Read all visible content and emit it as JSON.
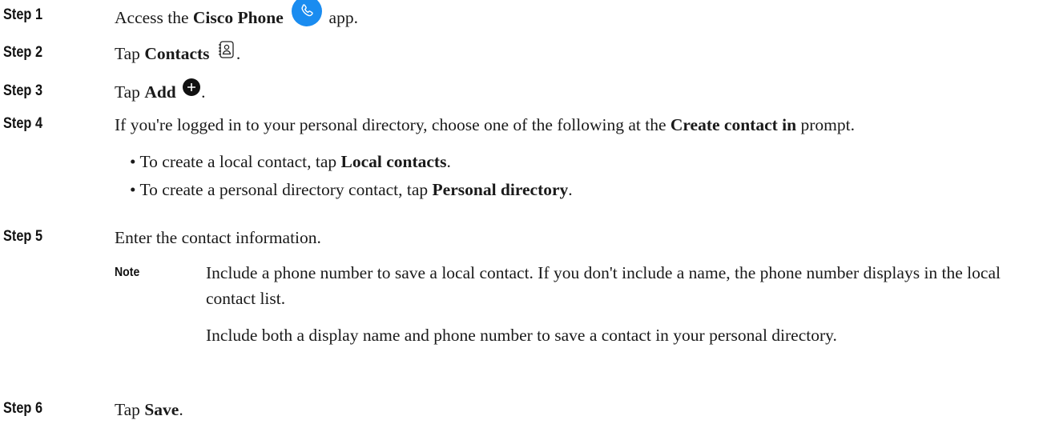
{
  "steps": [
    {
      "label": "Step 1",
      "before": "Access the ",
      "bold": "Cisco Phone",
      "icon": "phone-app-icon",
      "after": " app."
    },
    {
      "label": "Step 2",
      "before": "Tap ",
      "bold": "Contacts",
      "icon": "contacts-icon",
      "after": "."
    },
    {
      "label": "Step 3",
      "before": "Tap ",
      "bold": "Add",
      "icon": "add-icon",
      "after": "."
    },
    {
      "label": "Step 4",
      "before": "If you're logged in to your personal directory, choose one of the following at the ",
      "bold": "Create contact in",
      "after": " prompt.",
      "bullets": [
        {
          "before": "• To create a local contact, tap ",
          "bold": "Local contacts",
          "after": "."
        },
        {
          "before": "• To create a personal directory contact, tap ",
          "bold": "Personal directory",
          "after": "."
        }
      ]
    },
    {
      "label": "Step 5",
      "text": "Enter the contact information.",
      "note": {
        "label": "Note",
        "para1": "Include a phone number to save a local contact. If you don't include a name, the phone number displays in the local contact list.",
        "para2": "Include both a display name and phone number to save a contact in your personal directory."
      }
    },
    {
      "label": "Step 6",
      "before": "Tap ",
      "bold": "Save",
      "after": "."
    }
  ],
  "colors": {
    "phone_icon_bg": "#1a8cf0",
    "add_icon_bg": "#111111",
    "text": "#1a1a1a"
  }
}
